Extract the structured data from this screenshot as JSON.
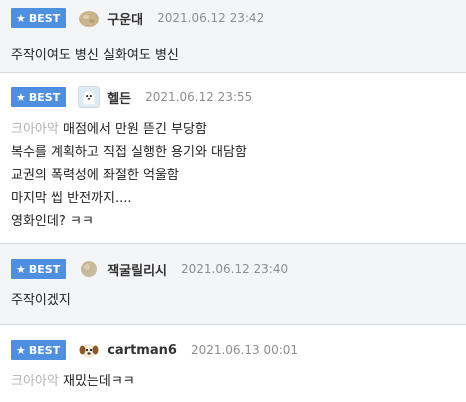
{
  "badge_label": "BEST",
  "badge_color": "#4f8fdf",
  "comments": [
    {
      "nickname": "구운대",
      "date": "2021.06.12 23:42",
      "avatar_icon": "tan-blob-avatar-icon",
      "prefix": "",
      "lines": [
        "주작이여도 병신 실화여도 병신"
      ]
    },
    {
      "nickname": "헬든",
      "date": "2021.06.12 23:55",
      "avatar_icon": "white-dog-avatar-icon",
      "prefix": "크아아악",
      "lines": [
        "매점에서 만원 뜯긴 부당함",
        "복수를 계획하고 직접 실행한 용기와 대담함",
        "교권의 폭력성에 좌절한 억울함",
        "마지막 씹 반전까지....",
        "영화인데? ㅋㅋ"
      ]
    },
    {
      "nickname": "잭굴릴리시",
      "date": "2021.06.12 23:40",
      "avatar_icon": "beige-circle-avatar-icon",
      "prefix": "",
      "lines": [
        "주작이겠지"
      ]
    },
    {
      "nickname": "cartman6",
      "date": "2021.06.13 00:01",
      "avatar_icon": "puppy-avatar-icon",
      "prefix": "크아아악",
      "lines": [
        "재밌는데ㅋㅋ"
      ]
    }
  ]
}
